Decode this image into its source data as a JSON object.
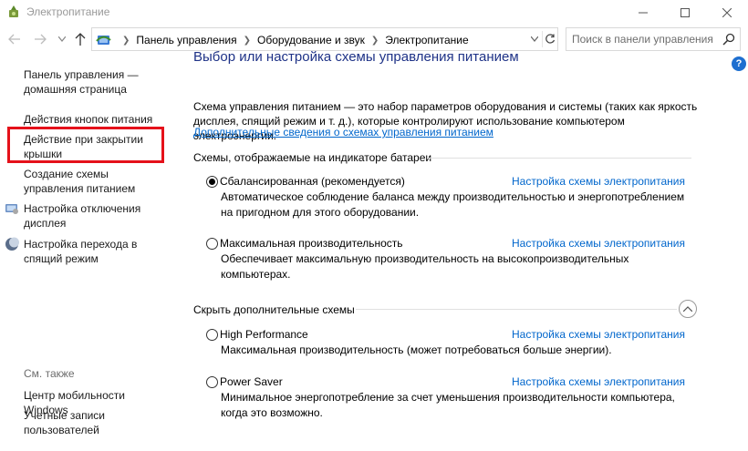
{
  "window": {
    "title": "Электропитание"
  },
  "nav": {
    "breadcrumbs": [
      "Панель управления",
      "Оборудование и звук",
      "Электропитание"
    ],
    "search_placeholder": "Поиск в панели управления"
  },
  "sidebar": {
    "items": [
      {
        "label": "Панель управления — домашняя страница"
      },
      {
        "label": "Действия кнопок питания"
      },
      {
        "label": "Действие при закрытии крышки"
      },
      {
        "label": "Создание схемы управления питанием"
      },
      {
        "label": "Настройка отключения дисплея",
        "icon": "display-icon"
      },
      {
        "label": "Настройка перехода в спящий режим",
        "icon": "moon-icon"
      }
    ],
    "see_also": {
      "heading": "См. также",
      "items": [
        {
          "label": "Центр мобильности Windows"
        },
        {
          "label": "Учетные записи пользователей"
        }
      ]
    }
  },
  "main": {
    "title": "Выбор или настройка схемы управления питанием",
    "description": "Схема управления питанием — это набор параметров оборудования и системы (таких как яркость дисплея, спящий режим и т. д.), которые контролируют использование компьютером электроэнергии.",
    "more_link": "Дополнительные сведения о схемах управления питанием",
    "battery_section": "Схемы, отображаемые на индикаторе батареи",
    "hidden_section": "Скрыть дополнительные схемы",
    "settings_link": "Настройка схемы электропитания",
    "plans": [
      {
        "name": "Сбалансированная (рекомендуется)",
        "description": "Автоматическое соблюдение баланса между производительностью и энергопотреблением на пригодном для этого оборудовании.",
        "selected": true
      },
      {
        "name": "Максимальная производительность",
        "description": "Обеспечивает максимальную производительность на высокопроизводительных компьютерах.",
        "selected": false
      },
      {
        "name": "High Performance",
        "description": "Максимальная производительность (может потребоваться больше энергии).",
        "selected": false
      },
      {
        "name": "Power Saver",
        "description": "Минимальное энергопотребление за счет уменьшения производительности компьютера, когда это возможно.",
        "selected": false
      }
    ]
  },
  "colors": {
    "title_blue": "#1e3287",
    "link_blue": "#0066cc",
    "highlight_red": "#e5111a"
  }
}
